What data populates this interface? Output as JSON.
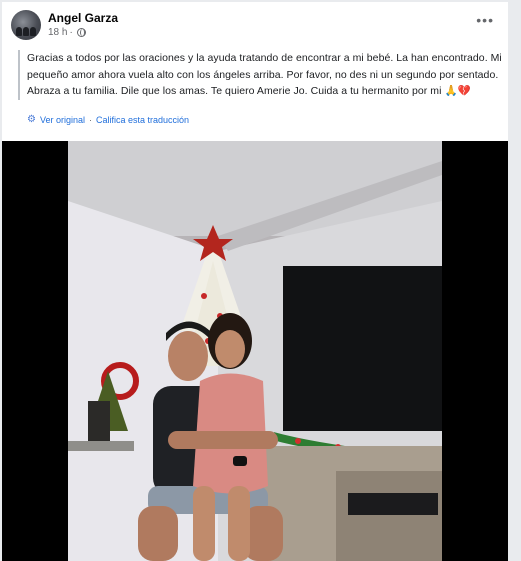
{
  "post": {
    "author": "Angel Garza",
    "time": "18 h",
    "time_separator": "·",
    "more_label": "•••",
    "text": "Gracias a todos por las oraciones y la ayuda tratando de encontrar a mi bebé. La han encontrado. Mi pequeño amor ahora vuela alto con los ángeles arriba. Por favor, no des ni un segundo por sentado. Abraza a tu familia. Dile que los amas. Te quiero Amerie Jo. Cuida a tu hermanito por mi 🙏💔",
    "see_original": "Ver original",
    "rate_translation": "Califica esta traducción",
    "translate_separator": "·",
    "icons": {
      "audience": "globe-icon",
      "translation": "gear-icon",
      "more": "more-horizontal-icon"
    }
  }
}
